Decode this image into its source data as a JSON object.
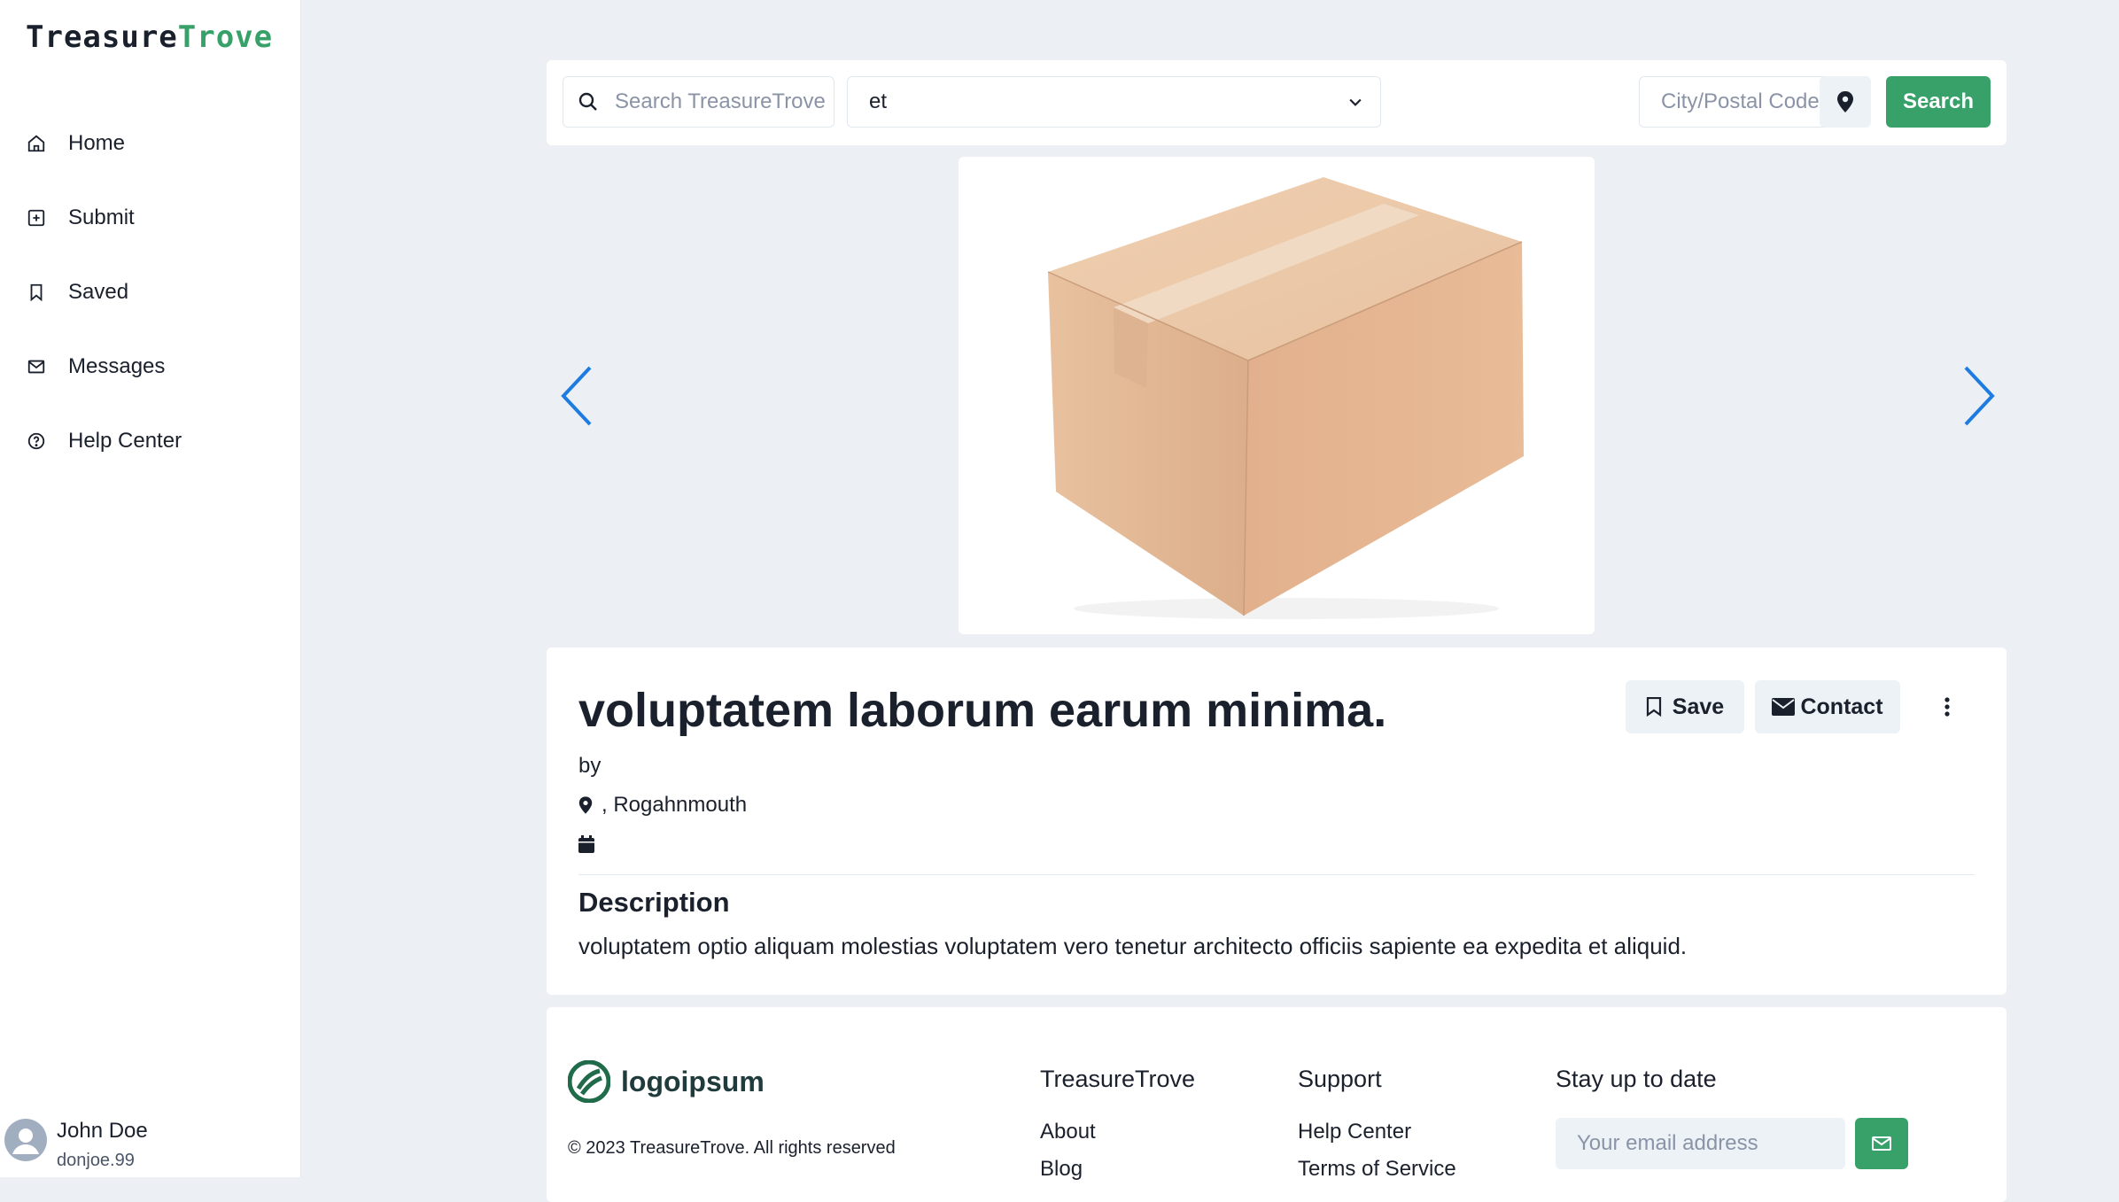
{
  "brand": {
    "part1": "Treasure",
    "part2": "Trove"
  },
  "sidebar": {
    "items": [
      {
        "label": "Home",
        "icon": "home-icon"
      },
      {
        "label": "Submit",
        "icon": "plus-square-icon"
      },
      {
        "label": "Saved",
        "icon": "bookmark-icon"
      },
      {
        "label": "Messages",
        "icon": "mail-icon"
      },
      {
        "label": "Help Center",
        "icon": "help-circle-icon"
      }
    ],
    "user": {
      "name": "John Doe",
      "username": "donjoe.99"
    }
  },
  "search": {
    "placeholder": "Search TreasureTrove",
    "category_value": "et",
    "location_placeholder": "City/Postal Code",
    "button_label": "Search"
  },
  "listing": {
    "title": "voluptatem laborum earum minima.",
    "by_label": "by",
    "location": ", Rogahnmouth",
    "save_label": "Save",
    "contact_label": "Contact",
    "description_heading": "Description",
    "description": "voluptatem optio aliquam molestias voluptatem vero tenetur architecto officiis sapiente ea expedita et aliquid."
  },
  "footer": {
    "logo_text": "logoipsum",
    "copyright": "© 2023 TreasureTrove. All rights reserved",
    "col1": {
      "heading": "TreasureTrove",
      "links": [
        "About",
        "Blog"
      ]
    },
    "col2": {
      "heading": "Support",
      "links": [
        "Help Center",
        "Terms of Service"
      ]
    },
    "newsletter": {
      "heading": "Stay up to date",
      "placeholder": "Your email address"
    }
  },
  "colors": {
    "accent": "#38a169",
    "arrow": "#1e7be0",
    "background": "#ecf0f4"
  }
}
